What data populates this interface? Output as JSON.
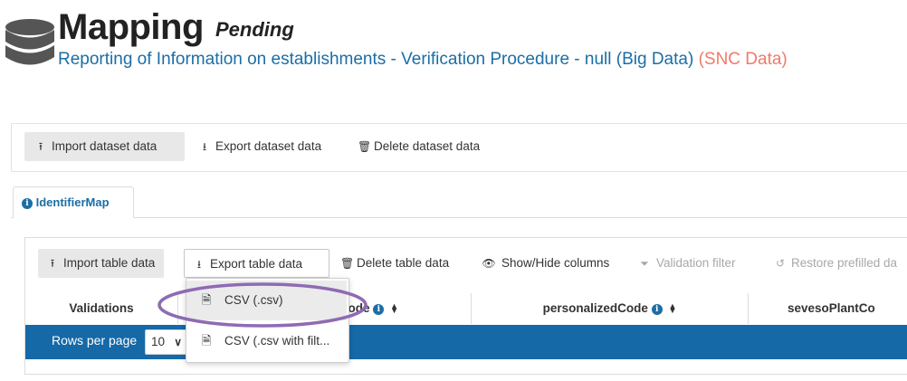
{
  "header": {
    "icon": "database-icon",
    "title": "Mapping",
    "status": "Pending",
    "subtitle": "Reporting of Information on establishments - Verification Procedure - null (Big Data)",
    "subtitle_tag": "(SNC Data)"
  },
  "dataset_toolbar": {
    "import_label": "Import dataset data",
    "export_label": "Export dataset data",
    "delete_label": "Delete dataset data"
  },
  "tabs": [
    {
      "label": "IdentifierMap",
      "icon": "info-icon",
      "active": true
    }
  ],
  "table_toolbar": {
    "import_label": "Import table data",
    "export_label": "Export table data",
    "delete_label": "Delete table data",
    "show_hide_label": "Show/Hide columns",
    "validation_filter_label": "Validation filter",
    "restore_label": "Restore prefilled da"
  },
  "columns": {
    "validations": "Validations",
    "col2_partial": "ode",
    "personalized_code": "personalizedCode",
    "seveso_partial": "sevesoPlantCo"
  },
  "pagination": {
    "rows_per_page_label": "Rows per page",
    "rows_per_page_value": "10"
  },
  "export_menu": {
    "items": [
      {
        "label": "CSV (.csv)",
        "icon": "file-icon",
        "highlighted": true
      },
      {
        "label": "CSV (.csv with filt...",
        "icon": "file-icon",
        "highlighted": false
      }
    ]
  },
  "colors": {
    "accent_blue": "#1569a7",
    "link_blue": "#1b6ea5",
    "snc_red": "#f07a6a",
    "annotation_purple": "#8e6bb3"
  }
}
